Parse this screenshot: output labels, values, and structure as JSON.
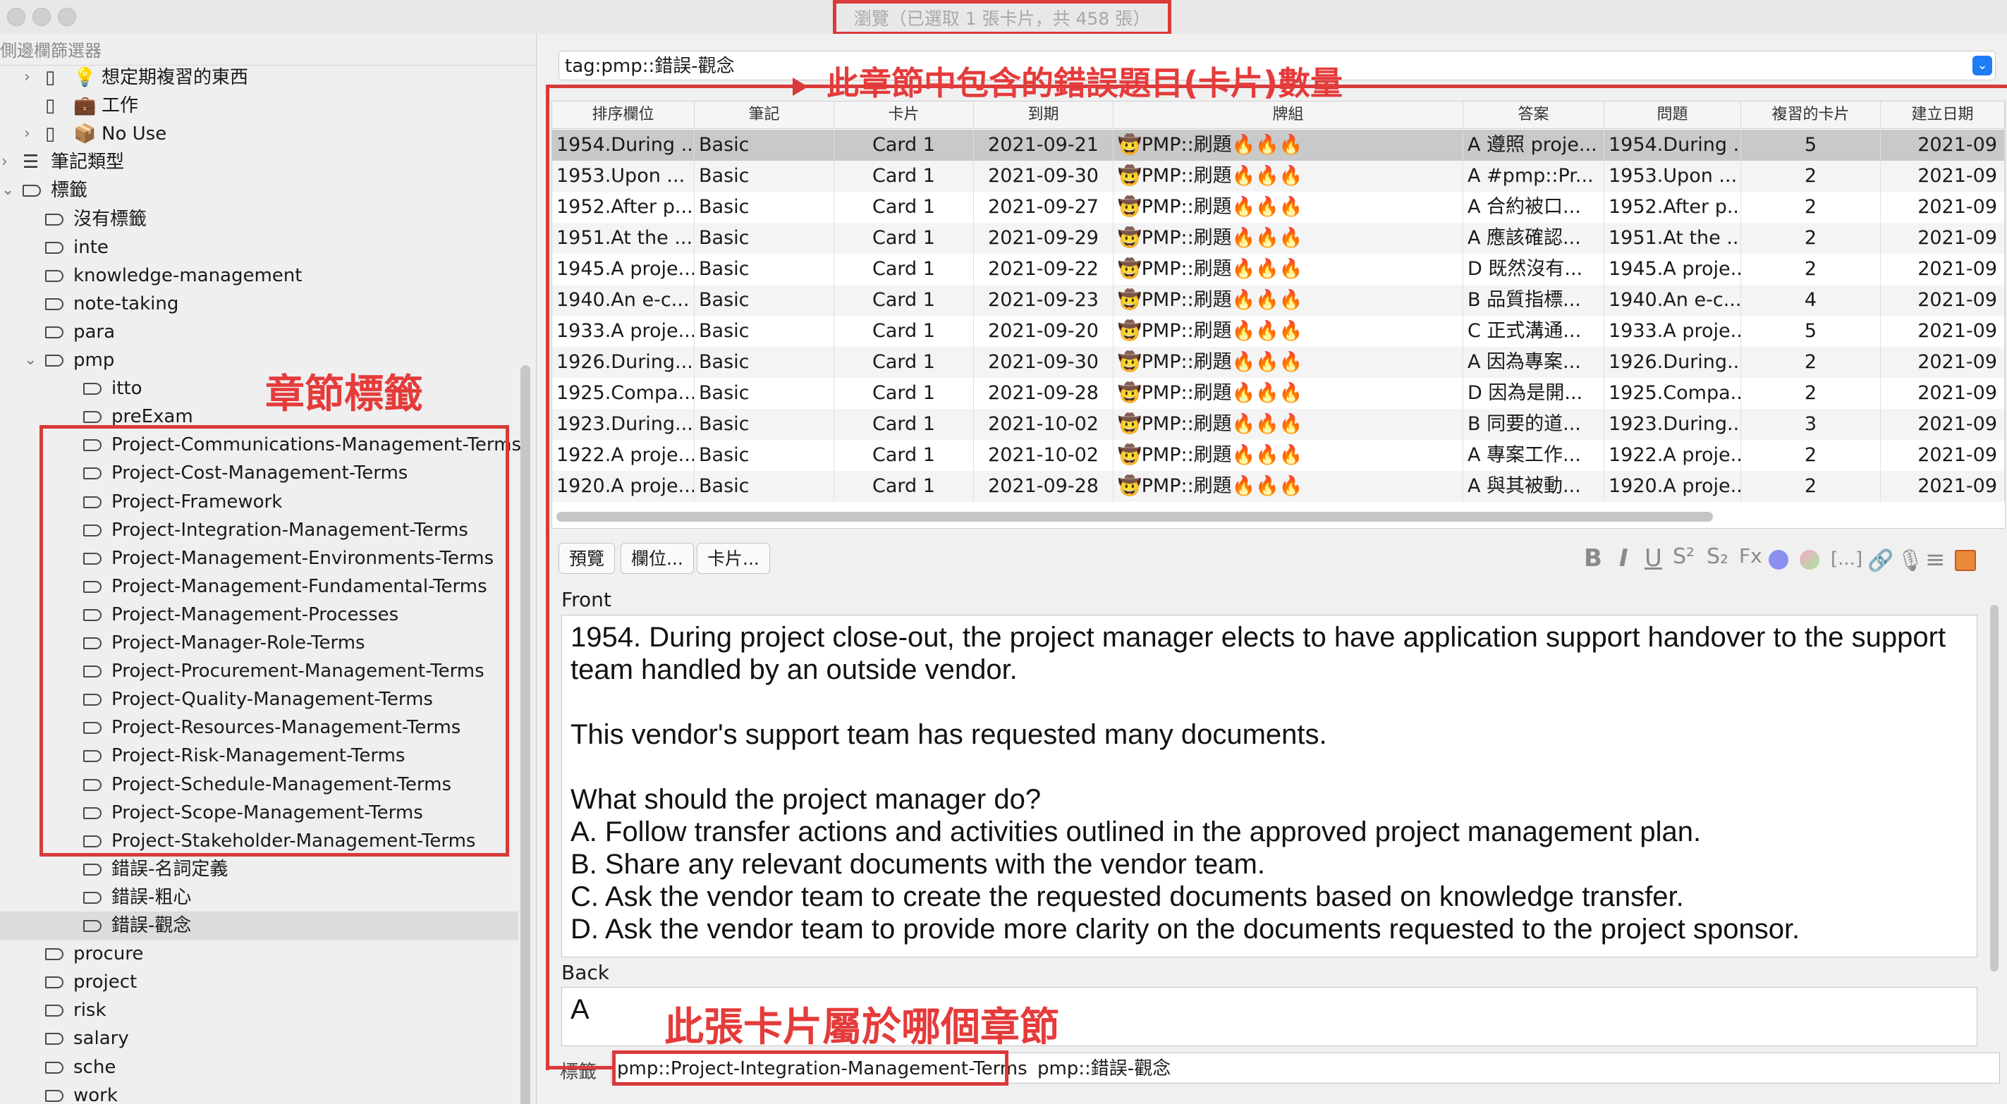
{
  "window": {
    "title": "瀏覽（已選取 1 張卡片，共 458 張）"
  },
  "sidebar": {
    "search_placeholder": "側邊欄篩選器",
    "items": [
      {
        "label": "想定期複習的東西",
        "icon": "💡",
        "level": 1,
        "kind": "deck",
        "twisty": "›"
      },
      {
        "label": "工作",
        "icon": "💼",
        "level": 1,
        "kind": "deck",
        "twisty": ""
      },
      {
        "label": "No Use",
        "icon": "📦",
        "level": 1,
        "kind": "deck",
        "twisty": "›"
      },
      {
        "label": "筆記類型",
        "level": 0,
        "kind": "notetype",
        "twisty": "›"
      },
      {
        "label": "標籤",
        "level": 0,
        "kind": "tag",
        "twisty": "⌄"
      },
      {
        "label": "沒有標籤",
        "level": 1,
        "kind": "tag",
        "twisty": ""
      },
      {
        "label": "inte",
        "level": 1,
        "kind": "tag",
        "twisty": ""
      },
      {
        "label": "knowledge-management",
        "level": 1,
        "kind": "tag",
        "twisty": ""
      },
      {
        "label": "note-taking",
        "level": 1,
        "kind": "tag",
        "twisty": ""
      },
      {
        "label": "para",
        "level": 1,
        "kind": "tag",
        "twisty": ""
      },
      {
        "label": "pmp",
        "level": 1,
        "kind": "tag",
        "twisty": "⌄"
      },
      {
        "label": "itto",
        "level": 2,
        "kind": "tag",
        "twisty": ""
      },
      {
        "label": "preExam",
        "level": 2,
        "kind": "tag",
        "twisty": ""
      },
      {
        "label": "Project-Communications-Management-Terms",
        "level": 2,
        "kind": "tag",
        "twisty": ""
      },
      {
        "label": "Project-Cost-Management-Terms",
        "level": 2,
        "kind": "tag",
        "twisty": ""
      },
      {
        "label": "Project-Framework",
        "level": 2,
        "kind": "tag",
        "twisty": ""
      },
      {
        "label": "Project-Integration-Management-Terms",
        "level": 2,
        "kind": "tag",
        "twisty": ""
      },
      {
        "label": "Project-Management-Environments-Terms",
        "level": 2,
        "kind": "tag",
        "twisty": ""
      },
      {
        "label": "Project-Management-Fundamental-Terms",
        "level": 2,
        "kind": "tag",
        "twisty": ""
      },
      {
        "label": "Project-Management-Processes",
        "level": 2,
        "kind": "tag",
        "twisty": ""
      },
      {
        "label": "Project-Manager-Role-Terms",
        "level": 2,
        "kind": "tag",
        "twisty": ""
      },
      {
        "label": "Project-Procurement-Management-Terms",
        "level": 2,
        "kind": "tag",
        "twisty": ""
      },
      {
        "label": "Project-Quality-Management-Terms",
        "level": 2,
        "kind": "tag",
        "twisty": ""
      },
      {
        "label": "Project-Resources-Management-Terms",
        "level": 2,
        "kind": "tag",
        "twisty": ""
      },
      {
        "label": "Project-Risk-Management-Terms",
        "level": 2,
        "kind": "tag",
        "twisty": ""
      },
      {
        "label": "Project-Schedule-Management-Terms",
        "level": 2,
        "kind": "tag",
        "twisty": ""
      },
      {
        "label": "Project-Scope-Management-Terms",
        "level": 2,
        "kind": "tag",
        "twisty": ""
      },
      {
        "label": "Project-Stakeholder-Management-Terms",
        "level": 2,
        "kind": "tag",
        "twisty": ""
      },
      {
        "label": "錯誤-名詞定義",
        "level": 2,
        "kind": "tag",
        "twisty": ""
      },
      {
        "label": "錯誤-粗心",
        "level": 2,
        "kind": "tag",
        "twisty": ""
      },
      {
        "label": "錯誤-觀念",
        "level": 2,
        "kind": "tag",
        "twisty": "",
        "selected": true
      },
      {
        "label": "procure",
        "level": 1,
        "kind": "tag",
        "twisty": ""
      },
      {
        "label": "project",
        "level": 1,
        "kind": "tag",
        "twisty": ""
      },
      {
        "label": "risk",
        "level": 1,
        "kind": "tag",
        "twisty": ""
      },
      {
        "label": "salary",
        "level": 1,
        "kind": "tag",
        "twisty": ""
      },
      {
        "label": "sche",
        "level": 1,
        "kind": "tag",
        "twisty": ""
      },
      {
        "label": "work",
        "level": 1,
        "kind": "tag",
        "twisty": ""
      }
    ]
  },
  "search": {
    "value": "tag:pmp::錯誤-觀念"
  },
  "table": {
    "columns": [
      "排序欄位",
      "筆記",
      "卡片",
      "到期",
      "牌組",
      "答案",
      "問題",
      "複習的卡片",
      "建立日期"
    ],
    "rows": [
      [
        "1954.During ...",
        "Basic",
        "Card 1",
        "2021-09-21",
        "🤠PMP::刷題🔥🔥🔥",
        "A  遵照 proje...",
        "1954.During ...",
        "5",
        "2021-09"
      ],
      [
        "1953.Upon ...",
        "Basic",
        "Card 1",
        "2021-09-30",
        "🤠PMP::刷題🔥🔥🔥",
        "A  #pmp::Pr...",
        "1953.Upon ...",
        "2",
        "2021-09"
      ],
      [
        "1952.After p...",
        "Basic",
        "Card 1",
        "2021-09-27",
        "🤠PMP::刷題🔥🔥🔥",
        "A  合約被口...",
        "1952.After p...",
        "2",
        "2021-09"
      ],
      [
        "1951.At the ...",
        "Basic",
        "Card 1",
        "2021-09-29",
        "🤠PMP::刷題🔥🔥🔥",
        "A  應該確認...",
        "1951.At the ...",
        "2",
        "2021-09"
      ],
      [
        "1945.A proje...",
        "Basic",
        "Card 1",
        "2021-09-22",
        "🤠PMP::刷題🔥🔥🔥",
        "D  既然沒有...",
        "1945.A proje...",
        "2",
        "2021-09"
      ],
      [
        "1940.An e-c...",
        "Basic",
        "Card 1",
        "2021-09-23",
        "🤠PMP::刷題🔥🔥🔥",
        "B  品質指標...",
        "1940.An e-c...",
        "4",
        "2021-09"
      ],
      [
        "1933.A proje...",
        "Basic",
        "Card 1",
        "2021-09-20",
        "🤠PMP::刷題🔥🔥🔥",
        "C  正式溝通...",
        "1933.A proje...",
        "5",
        "2021-09"
      ],
      [
        "1926.During...",
        "Basic",
        "Card 1",
        "2021-09-30",
        "🤠PMP::刷題🔥🔥🔥",
        "A  因為專案...",
        "1926.During...",
        "2",
        "2021-09"
      ],
      [
        "1925.Compa...",
        "Basic",
        "Card 1",
        "2021-09-28",
        "🤠PMP::刷題🔥🔥🔥",
        "D  因為是開...",
        "1925.Compa...",
        "2",
        "2021-09"
      ],
      [
        "1923.During...",
        "Basic",
        "Card 1",
        "2021-10-02",
        "🤠PMP::刷題🔥🔥🔥",
        "B  同要的道...",
        "1923.During...",
        "3",
        "2021-09"
      ],
      [
        "1922.A proje...",
        "Basic",
        "Card 1",
        "2021-10-02",
        "🤠PMP::刷題🔥🔥🔥",
        "A  專案工作...",
        "1922.A proje...",
        "2",
        "2021-09"
      ],
      [
        "1920.A proje...",
        "Basic",
        "Card 1",
        "2021-09-28",
        "🤠PMP::刷題🔥🔥🔥",
        "A  與其被動...",
        "1920.A proje...",
        "2",
        "2021-09"
      ]
    ]
  },
  "editor_toolbar": {
    "preview_label": "預覽",
    "fields_label": "欄位...",
    "cards_label": "卡片...",
    "format_icons": [
      "B",
      "I",
      "U",
      "S²",
      "S₂",
      "Fx",
      "[...]"
    ]
  },
  "front": {
    "label": "Front",
    "lines": [
      "1954. During project close-out, the project manager elects to have application support handover to the support team handled by an outside vendor.",
      "",
      "This vendor's support team has requested many documents.",
      "",
      "What should the project manager do?",
      "A. Follow transfer actions and activities outlined in the approved project management plan.",
      "B. Share any relevant documents with the vendor team.",
      "C. Ask the vendor team to create the requested documents based on knowledge transfer.",
      "D. Ask the vendor team to provide more clarity on the documents requested to the project sponsor."
    ]
  },
  "back": {
    "label": "Back",
    "value": "A"
  },
  "tags": {
    "label": "標籤",
    "tag1": "pmp::Project-Integration-Management-Terms",
    "tag2": "pmp::錯誤-觀念"
  },
  "annotations": {
    "chapter_tags": "章節標籤",
    "count_note": "此章節中包含的錯誤題目(卡片)數量",
    "which_chapter": "此張卡片屬於哪個章節"
  },
  "colors": {
    "annotation": "#d93a3a",
    "selected_row": "#c9c9c9",
    "accent": "#1e7cf5"
  }
}
